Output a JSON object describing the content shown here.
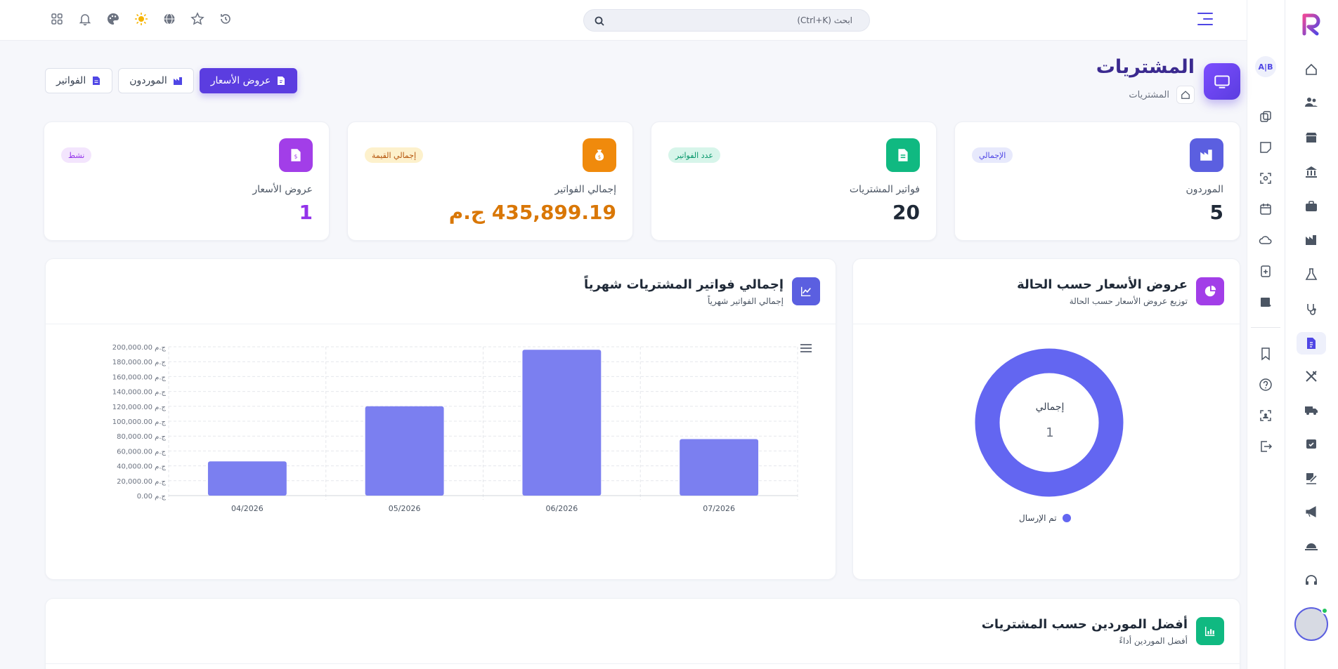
{
  "topbar": {
    "search_placeholder": "ابحث (Ctrl+K)",
    "icons": [
      "apps-icon",
      "bell-icon",
      "palette-icon",
      "sun-icon",
      "globe-icon",
      "star-icon",
      "history-icon"
    ]
  },
  "rail": {
    "icons": [
      "home-icon",
      "users-icon",
      "store-icon",
      "bank-icon",
      "briefcase-icon",
      "factory-icon",
      "flask-icon",
      "stethoscope-icon",
      "invoice-icon",
      "tools-icon",
      "truck-icon",
      "calendar-check-icon",
      "signature-icon",
      "megaphone-icon",
      "hat-icon",
      "headset-icon",
      "settings-icon"
    ],
    "active": "invoice-icon"
  },
  "rail2": {
    "language_badge": "A|B",
    "icons": [
      "copy-icon",
      "note-icon",
      "scan-icon",
      "calendar-add-icon",
      "cloud-icon",
      "clipboard-plus-icon",
      "wallet-icon",
      "bookmark-icon",
      "help-icon",
      "face-scan-icon",
      "logout-icon"
    ]
  },
  "page": {
    "title": "المشتريات",
    "breadcrumb": "المشتريات"
  },
  "header_buttons": {
    "quotes": "عروض الأسعار",
    "suppliers": "الموردون",
    "invoices": "الفواتير"
  },
  "stats": [
    {
      "label": "الموردون",
      "value": "5",
      "tag": "الإجمالي",
      "color": "#4f46e5"
    },
    {
      "label": "فواتير المشتريات",
      "value": "20",
      "tag": "عدد الفواتير",
      "color": "#10b981"
    },
    {
      "label": "إجمالي الفواتير",
      "value": "435,899.19 ج.م",
      "tag": "إجمالي القيمة",
      "color": "#d97706"
    },
    {
      "label": "عروض الأسعار",
      "value": "1",
      "tag": "نشط",
      "color": "#9333ea"
    }
  ],
  "donut_panel": {
    "title": "عروض الأسعار حسب الحالة",
    "subtitle": "توزيع عروض الأسعار حسب الحالة",
    "center_label": "إجمالي",
    "center_value": "1",
    "legend": "تم الإرسال",
    "color": "#6366f1"
  },
  "bar_panel": {
    "title": "إجمالي فواتير المشتريات شهرياً",
    "subtitle": "إجمالي الفواتير شهرياً"
  },
  "bottom_panel": {
    "title": "أفضل الموردين حسب المشتريات",
    "subtitle": "أفضل الموردين أداءً"
  },
  "chart_data": {
    "type": "bar",
    "categories": [
      "04/2026",
      "05/2026",
      "06/2026",
      "07/2026"
    ],
    "values": [
      46000,
      120000,
      196000,
      76000
    ],
    "ylim": [
      0,
      200000
    ],
    "y_ticks": [
      "0.00 ج.م",
      "20,000.00 ج.م",
      "40,000.00 ج.م",
      "60,000.00 ج.م",
      "80,000.00 ج.م",
      "100,000.00 ج.م",
      "120,000.00 ج.م",
      "140,000.00 ج.م",
      "160,000.00 ج.م",
      "180,000.00 ج.م",
      "200,000.00 ج.م"
    ],
    "y_tick_values": [
      0,
      20000,
      40000,
      60000,
      80000,
      100000,
      120000,
      140000,
      160000,
      180000,
      200000
    ],
    "grid": true,
    "color": "#7b7ff0"
  }
}
